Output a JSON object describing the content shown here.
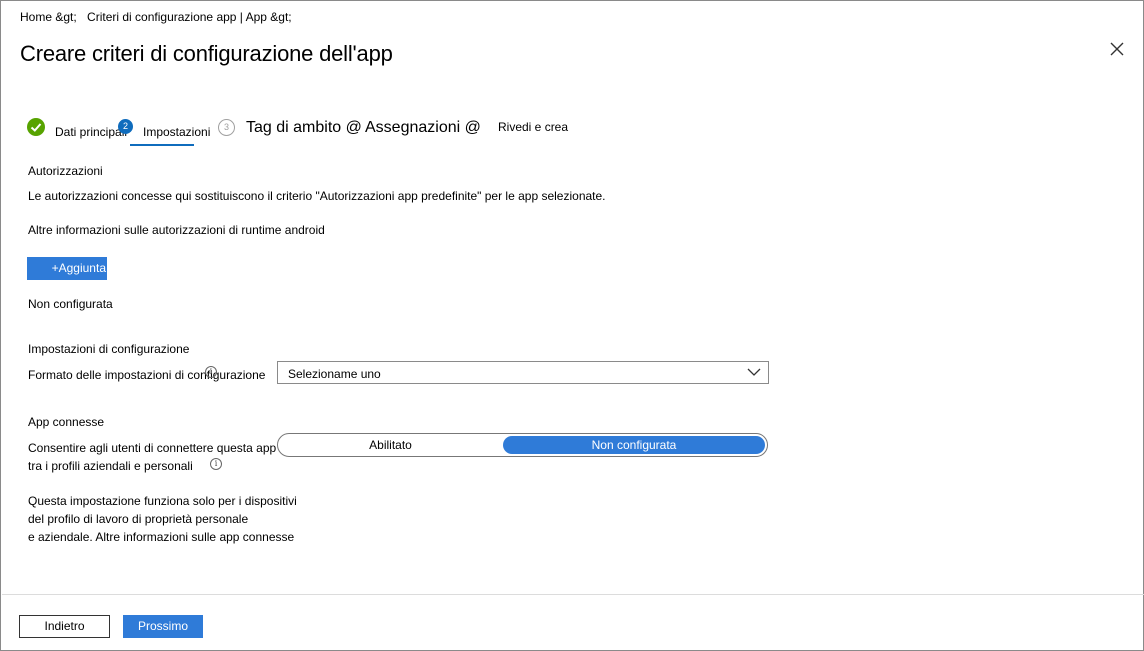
{
  "breadcrumb": [
    "Home &gt;",
    "Criteri di configurazione app | App &gt;"
  ],
  "title": "Creare criteri di configurazione dell'app",
  "steps": [
    {
      "label": "Dati principali",
      "status": "completed"
    },
    {
      "label": "Impostazioni",
      "number": "2",
      "status": "active"
    },
    {
      "label": "Tag di ambito @",
      "number": "3",
      "status": "pending"
    },
    {
      "label": "Assegnazioni @",
      "status": "pending"
    },
    {
      "label": "Rivedi e crea",
      "status": "pending"
    }
  ],
  "permissions": {
    "heading": "Autorizzazioni",
    "description": "Le autorizzazioni concesse qui sostituiscono il criterio \"Autorizzazioni app predefinite\" per le app selezionate.",
    "link": "Altre informazioni sulle autorizzazioni di runtime android",
    "add_button": "+Aggiunta",
    "status": "Non configurata"
  },
  "config_settings": {
    "heading": "Impostazioni di configurazione",
    "format_label": "Formato delle impostazioni di configurazione",
    "format_value": "Selezioname uno"
  },
  "connected_apps": {
    "heading": "App connesse",
    "label_line1": "Consentire agli utenti di connettere questa app",
    "label_line2": "tra i profili aziendali e personali",
    "toggle_left": "Abilitato",
    "toggle_right": "Non configurata",
    "selected": "Non configurata",
    "note_line1": "Questa impostazione funziona solo per i dispositivi",
    "note_line2": "del profilo di lavoro di proprietà personale",
    "note_line3": "e aziendale. Altre informazioni sulle app connesse"
  },
  "footer": {
    "back": "Indietro",
    "next": "Prossimo"
  },
  "colors": {
    "accent": "#2f7bd8",
    "active_step": "#0f6cbd",
    "completed": "#57a300"
  }
}
